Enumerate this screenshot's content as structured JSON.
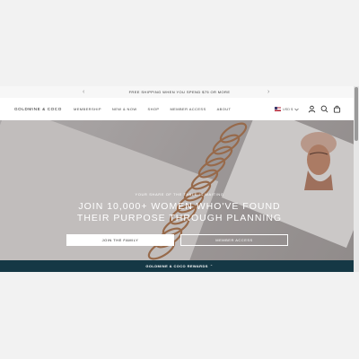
{
  "announcement": {
    "message": "FREE SHIPPING WHEN YOU SPEND $75 OR MORE",
    "prev_icon": "chevron-left-icon",
    "next_icon": "chevron-right-icon"
  },
  "header": {
    "logo": "GOLDMINE & COCO",
    "nav": [
      "MEMBERSHIP",
      "NEW & NOW",
      "SHOP",
      "MEMBER ACCESS",
      "ABOUT"
    ],
    "currency": "USD $",
    "icons": [
      "us-flag-icon",
      "account-icon",
      "search-icon",
      "cart-bag-icon"
    ]
  },
  "hero": {
    "eyebrow": "YOUR SHARE OF THE TABLE IS WAITING",
    "headline_line1": "JOIN 10,000+ WOMEN WHO'VE FOUND",
    "headline_line2": "THEIR PURPOSE THROUGH PLANNING",
    "primary_button": "JOIN THE FAMILY",
    "secondary_button": "MEMBER ACCESS"
  },
  "rewards_bar": {
    "label": "GOLDMINE & COCO REWARDS",
    "chevron": "⌃"
  },
  "colors": {
    "rewards_bg": "#153845",
    "announcement_bg": "#f7f7f7",
    "page_bg": "#f2f2f2"
  }
}
